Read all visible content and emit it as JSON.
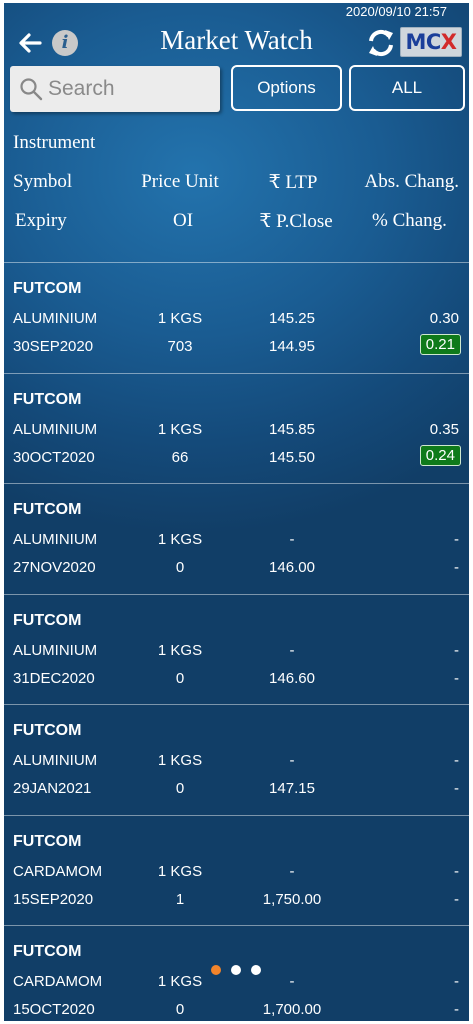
{
  "status": {
    "datetime": "2020/09/10 21:57"
  },
  "header": {
    "title": "Market Watch",
    "logo_text_main": "MC",
    "logo_text_accent": "X"
  },
  "search": {
    "placeholder": "Search"
  },
  "buttons": {
    "options": "Options",
    "all": "ALL"
  },
  "columns": {
    "instrument": "Instrument",
    "symbol": "Symbol",
    "expiry": "Expiry",
    "price_unit": "Price Unit",
    "oi": "OI",
    "ltp": "₹ LTP",
    "p_close": "₹ P.Close",
    "abs_change": "Abs. Chang.",
    "pct_change": "% Chang."
  },
  "rows": [
    {
      "instrument": "FUTCOM",
      "symbol": "ALUMINIUM",
      "expiry": "30SEP2020",
      "unit": "1 KGS",
      "oi": "703",
      "ltp": "145.25",
      "p_close": "144.95",
      "abs": "0.30",
      "pct": "0.21",
      "pct_badge": true
    },
    {
      "instrument": "FUTCOM",
      "symbol": "ALUMINIUM",
      "expiry": "30OCT2020",
      "unit": "1 KGS",
      "oi": "66",
      "ltp": "145.85",
      "p_close": "145.50",
      "abs": "0.35",
      "pct": "0.24",
      "pct_badge": true
    },
    {
      "instrument": "FUTCOM",
      "symbol": "ALUMINIUM",
      "expiry": "27NOV2020",
      "unit": "1 KGS",
      "oi": "0",
      "ltp": "-",
      "p_close": "146.00",
      "abs": "-",
      "pct": "-",
      "pct_badge": false
    },
    {
      "instrument": "FUTCOM",
      "symbol": "ALUMINIUM",
      "expiry": "31DEC2020",
      "unit": "1 KGS",
      "oi": "0",
      "ltp": "-",
      "p_close": "146.60",
      "abs": "-",
      "pct": "-",
      "pct_badge": false
    },
    {
      "instrument": "FUTCOM",
      "symbol": "ALUMINIUM",
      "expiry": "29JAN2021",
      "unit": "1 KGS",
      "oi": "0",
      "ltp": "-",
      "p_close": "147.15",
      "abs": "-",
      "pct": "-",
      "pct_badge": false
    },
    {
      "instrument": "FUTCOM",
      "symbol": "CARDAMOM",
      "expiry": "15SEP2020",
      "unit": "1 KGS",
      "oi": "1",
      "ltp": "-",
      "p_close": "1,750.00",
      "abs": "-",
      "pct": "-",
      "pct_badge": false
    },
    {
      "instrument": "FUTCOM",
      "symbol": "CARDAMOM",
      "expiry": "15OCT2020",
      "unit": "1 KGS",
      "oi": "0",
      "ltp": "-",
      "p_close": "1,700.00",
      "abs": "-",
      "pct": "-",
      "pct_badge": false
    }
  ],
  "pager": {
    "pages": 3,
    "current": 0
  },
  "colors": {
    "accent_dot": "#f2842b",
    "badge_green": "#0f7a1a",
    "mcx_blue": "#1b3f9a",
    "mcx_red": "#d22a2a"
  },
  "icons": {
    "back": "back-arrow-icon",
    "info": "info-icon",
    "refresh": "refresh-icon",
    "search": "search-icon"
  }
}
